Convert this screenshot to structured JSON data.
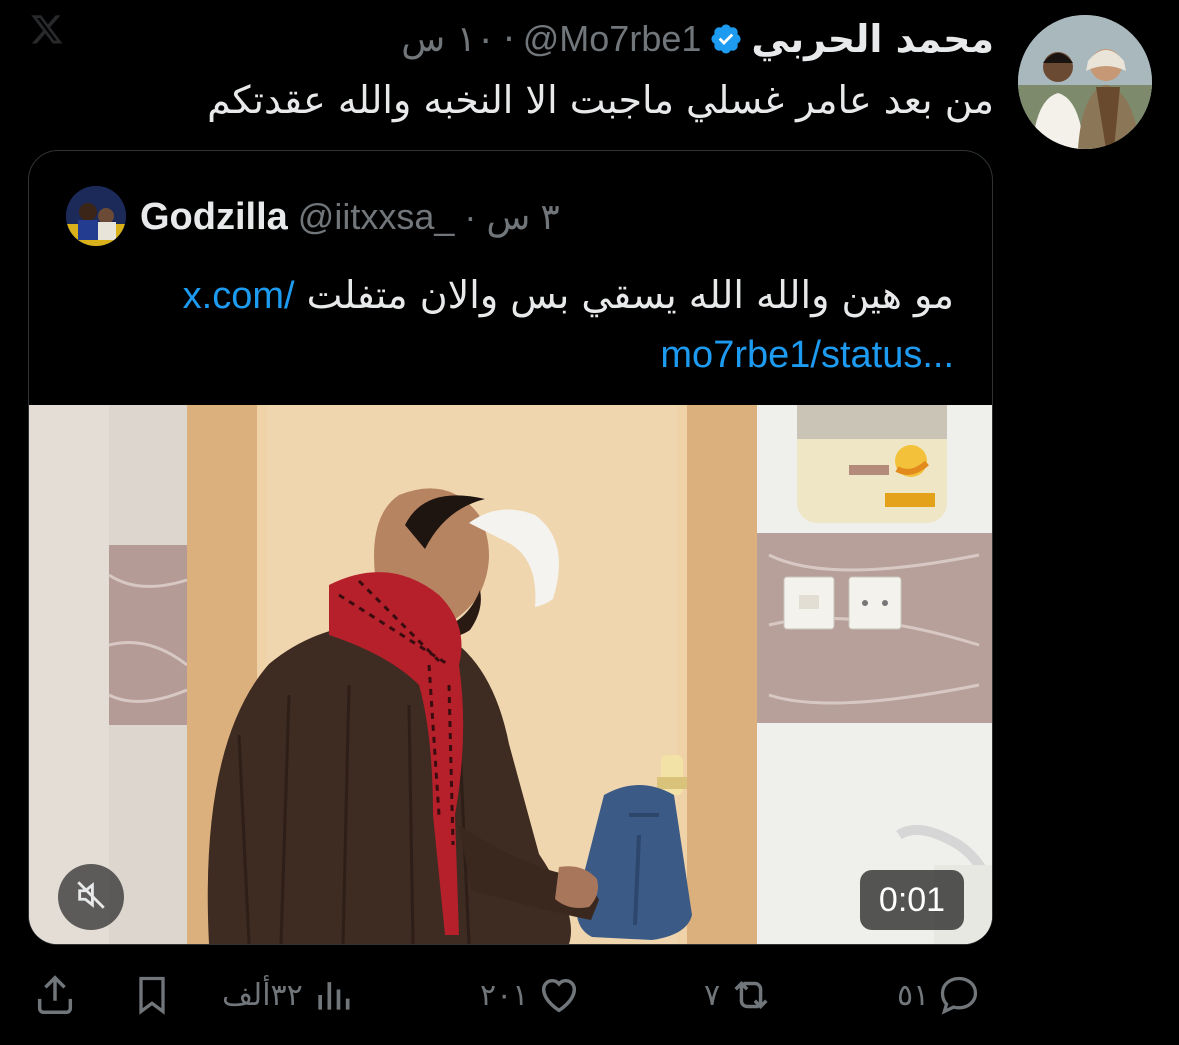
{
  "tweet": {
    "author_name": "محمد الحربي",
    "handle": "@Mo7rbe1",
    "separator": "·",
    "time": "١٠ س",
    "text": "من بعد عامر غسلي ماجبت الا النخبه والله عقدتكم",
    "verified": true
  },
  "quote": {
    "name": "Godzilla",
    "handle": "@iitxxsa_",
    "separator": "·",
    "time": "٣ س",
    "text": "مو هين والله الله يسقي بس والان متفلت",
    "link_line1": "x.com/",
    "link_line2": "mo7rbe1/status...",
    "video": {
      "duration": "0:01",
      "muted": true
    }
  },
  "actions": {
    "replies": "٥١",
    "reposts": "٧",
    "likes": "٢٠١",
    "views": "٣٢ألف"
  },
  "colors": {
    "background": "#000000",
    "text": "#e7e9ea",
    "muted": "#71767b",
    "link": "#1d9bf0",
    "border": "#2f3336",
    "verified": "#1d9bf0"
  },
  "icons": [
    "x-logo-icon",
    "verified-badge-icon",
    "mute-icon",
    "reply-icon",
    "repost-icon",
    "like-icon",
    "views-icon",
    "bookmark-icon",
    "share-icon"
  ]
}
